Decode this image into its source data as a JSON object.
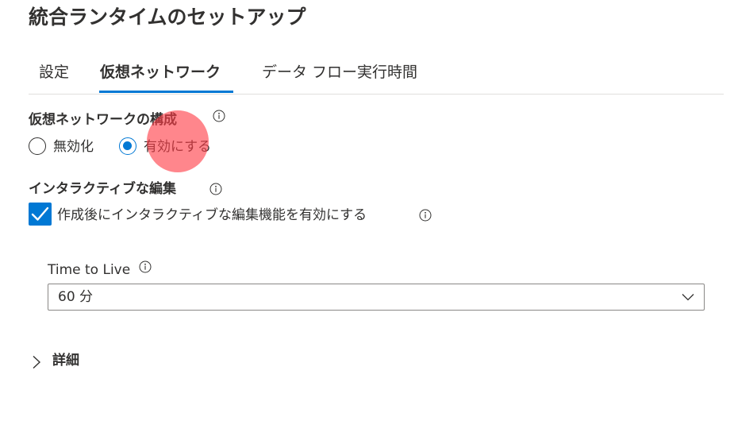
{
  "page": {
    "title": "統合ランタイムのセットアップ"
  },
  "tabs": [
    {
      "label": "設定",
      "active": false
    },
    {
      "label": "仮想ネットワーク",
      "active": true
    },
    {
      "label": "データ フロー実行時間",
      "active": false
    }
  ],
  "vnet_config": {
    "label": "仮想ネットワークの構成",
    "info_icon": "info-icon",
    "options": [
      {
        "label": "無効化",
        "selected": false
      },
      {
        "label": "有効にする",
        "selected": true
      }
    ]
  },
  "interactive_authoring": {
    "label": "インタラクティブな編集",
    "info_icon": "info-icon",
    "checkbox_label": "作成後にインタラクティブな編集機能を有効にする",
    "checked": true
  },
  "time_to_live": {
    "label": "Time to Live",
    "info_icon": "info-icon",
    "selected_value": "60 分"
  },
  "details": {
    "label": "詳細",
    "expanded": false
  },
  "colors": {
    "accent": "#0078d4",
    "text": "#323130",
    "border": "#8a8886",
    "touch_marker": "#ff3c46"
  }
}
